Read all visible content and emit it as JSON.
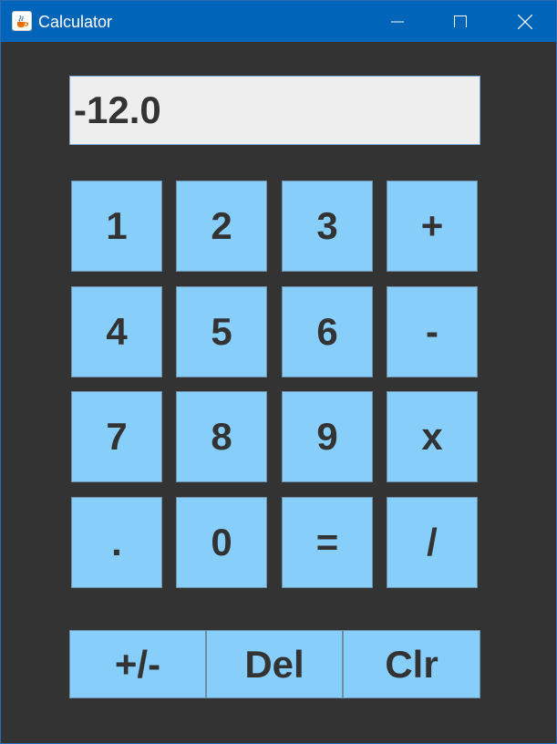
{
  "window": {
    "title": "Calculator",
    "controls": [
      "minimize",
      "maximize",
      "close"
    ]
  },
  "display": {
    "value": "-12.0"
  },
  "keypad": {
    "rows": [
      [
        "1",
        "2",
        "3",
        "+"
      ],
      [
        "4",
        "5",
        "6",
        "-"
      ],
      [
        "7",
        "8",
        "9",
        "x"
      ],
      [
        ".",
        "0",
        "=",
        "/"
      ]
    ]
  },
  "bottom_row": {
    "negate_label": "+/-",
    "delete_label": "Del",
    "clear_label": "Clr"
  },
  "colors": {
    "titlebar": "#0064b8",
    "background": "#333333",
    "key": "#87cefa",
    "key_text": "#333333",
    "display_bg": "#eeeeee"
  },
  "icons": {
    "app": "java-coffee-cup-icon",
    "minimize": "minimize-icon",
    "maximize": "maximize-icon",
    "close": "close-icon"
  }
}
